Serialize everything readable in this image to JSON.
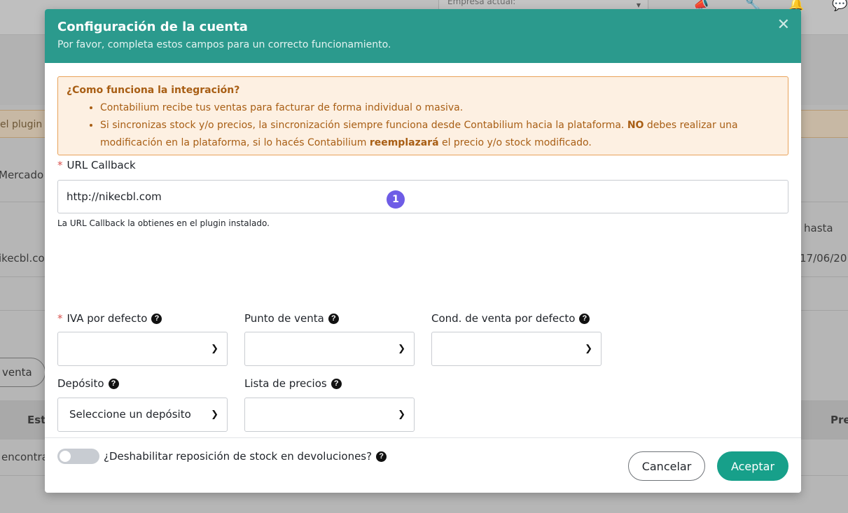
{
  "background": {
    "company_placeholder": "Empresa actual:",
    "warning_fragment": "el plugin",
    "mercado_fragment": "Mercado",
    "hasta_fragment": "hasta",
    "url_fragment": "ikecbl.co",
    "date_fragment": "17/06/20",
    "venta_button": "venta",
    "table_col_est": "Est",
    "table_col_pre": "Pre",
    "empty_fragment": "encontra"
  },
  "modal": {
    "title": "Configuración de la cuenta",
    "subtitle": "Por favor, completa estos campos para un correcto funcionamiento.",
    "info": {
      "title": "¿Como funciona la integración?",
      "item1": "Contabilium recibe tus ventas para facturar de forma individual o masiva.",
      "item2_part1": "Si sincronizas stock y/o precios, la sincronización siempre funciona desde Contabilium hacia la plataforma.",
      "item2_bold1": "NO",
      "item2_part2": "debes realizar una modificación en la plataforma, si lo hacés Contabilium",
      "item2_bold2": "reemplazará",
      "item2_part3": "el precio y/o stock modificado."
    },
    "url_callback": {
      "required_mark": "*",
      "label": "URL Callback",
      "value": "http://nikecbl.com",
      "badge": "1",
      "hint": "La URL Callback la obtienes en el plugin instalado."
    },
    "fields": {
      "iva_label": "IVA por defecto",
      "iva_value": "",
      "punto_label": "Punto de venta",
      "punto_value": "",
      "cond_label": "Cond. de venta por defecto",
      "cond_value": "",
      "deposito_label": "Depósito",
      "deposito_value": "Seleccione un depósito",
      "lista_label": "Lista de precios",
      "lista_value": ""
    },
    "toggle": {
      "label": "¿Deshabilitar reposición de stock en devoluciones?",
      "checked": false
    },
    "buttons": {
      "cancel": "Cancelar",
      "accept": "Aceptar"
    }
  },
  "colors": {
    "header": "#2b9a8d",
    "accept": "#17a08a",
    "info_border": "#e8a25a",
    "info_text": "#a85e14",
    "badge": "#6e5ce6"
  }
}
